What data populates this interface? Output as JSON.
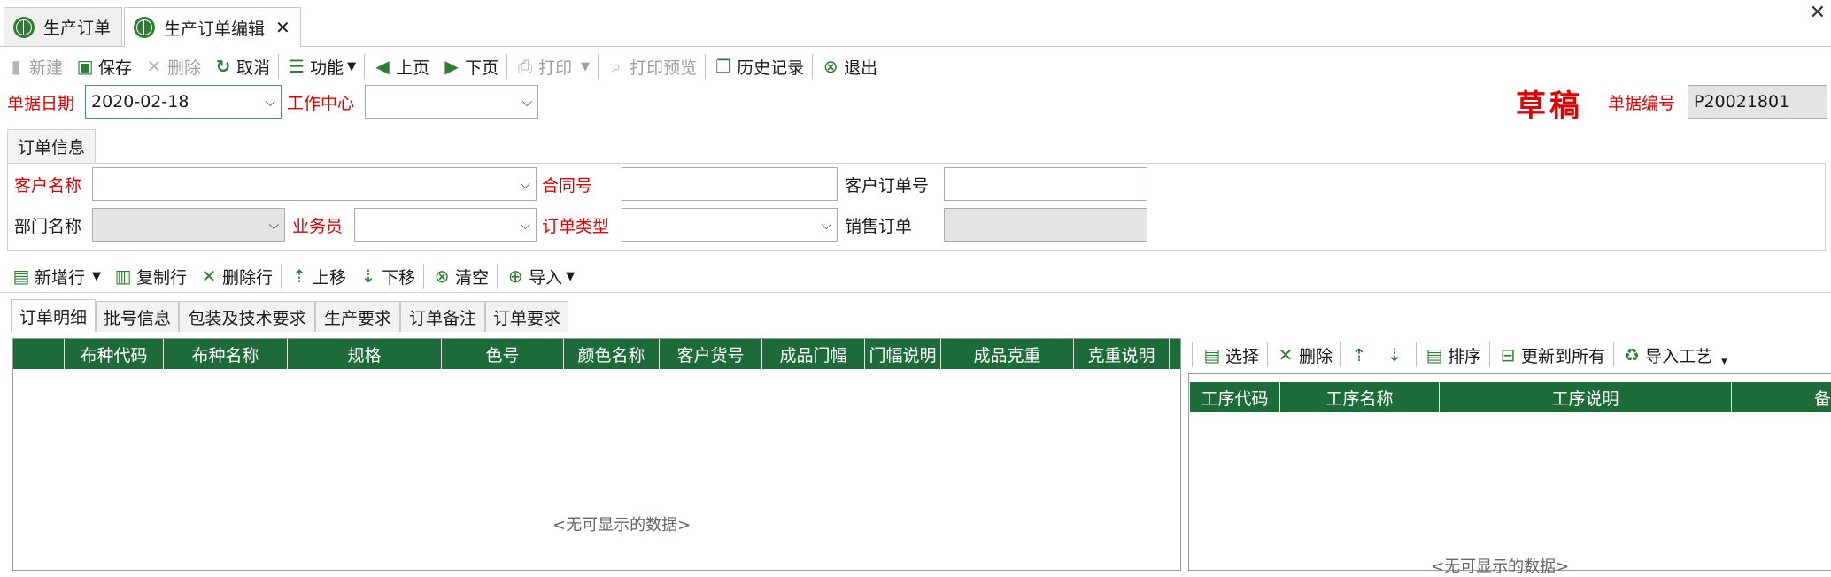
{
  "tabs": [
    {
      "label": "生产订单",
      "active": false
    },
    {
      "label": "生产订单编辑",
      "active": true,
      "closable": true
    }
  ],
  "toolbar": {
    "new": "新建",
    "save": "保存",
    "delete": "删除",
    "cancel": "取消",
    "function": "功能",
    "prev": "上页",
    "next": "下页",
    "print": "打印",
    "print_preview": "打印预览",
    "history": "历史记录",
    "exit": "退出"
  },
  "header": {
    "date_label": "单据日期",
    "date_value": "2020-02-18",
    "workcenter_label": "工作中心",
    "workcenter_value": "",
    "status": "草稿",
    "docno_label": "单据编号",
    "docno_value": "P20021801"
  },
  "order_info": {
    "tab_label": "订单信息",
    "customer_label": "客户名称",
    "customer_value": "",
    "contract_label": "合同号",
    "contract_value": "",
    "customer_order_label": "客户订单号",
    "customer_order_value": "",
    "dept_label": "部门名称",
    "dept_value": "",
    "salesman_label": "业务员",
    "salesman_value": "",
    "order_type_label": "订单类型",
    "order_type_value": "",
    "sales_order_label": "销售订单",
    "sales_order_value": ""
  },
  "row_toolbar": {
    "add_row": "新增行",
    "copy_row": "复制行",
    "delete_row": "删除行",
    "move_up": "上移",
    "move_down": "下移",
    "clear": "清空",
    "import": "导入"
  },
  "detail_tabs": [
    "订单明细",
    "批号信息",
    "包装及技术要求",
    "生产要求",
    "订单备注",
    "订单要求"
  ],
  "detail_grid": {
    "columns": [
      "布种代码",
      "布种名称",
      "规格",
      "色号",
      "颜色名称",
      "客户货号",
      "成品门幅",
      "门幅说明",
      "成品克重",
      "克重说明"
    ],
    "empty_text": "<无可显示的数据>"
  },
  "process_toolbar": {
    "select": "选择",
    "delete": "删除",
    "sort": "排序",
    "update_all": "更新到所有",
    "import_process": "导入工艺"
  },
  "process_grid": {
    "columns": [
      "工序代码",
      "工序名称",
      "工序说明",
      "备"
    ],
    "empty_text": "<无可显示的数据>"
  },
  "colors": {
    "accent_red": "#e00000",
    "grid_header": "#1e6b3a",
    "icon_green": "#2e7d32"
  }
}
